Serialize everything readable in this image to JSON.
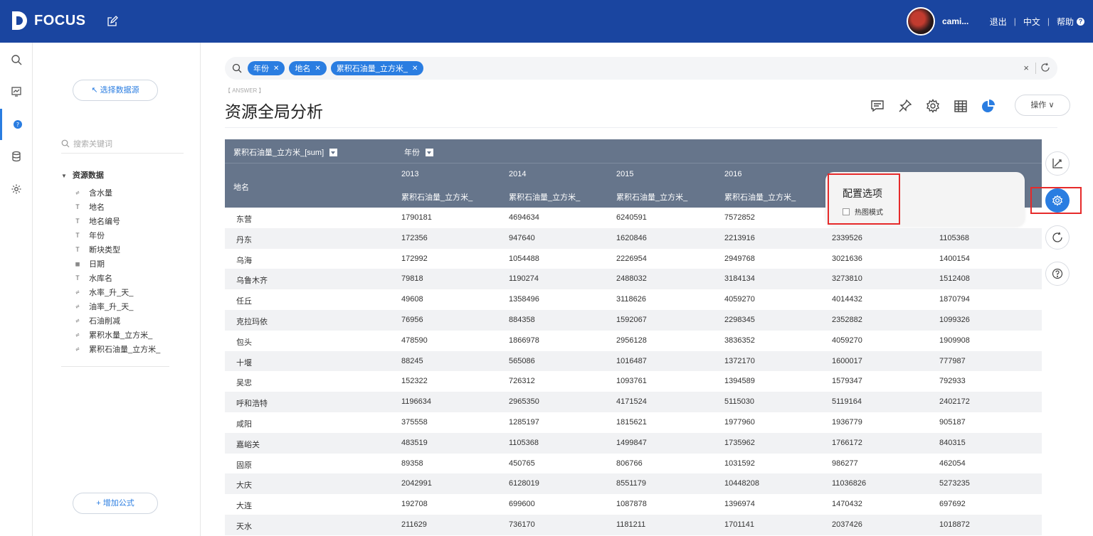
{
  "app": {
    "logo_text": "FOCUS"
  },
  "topbar": {
    "username": "cami...",
    "logout": "退出",
    "language": "中文",
    "help": "帮助"
  },
  "left_panel": {
    "select_source_label": "↖ 选择数据源",
    "search_placeholder": "搜索关键词",
    "group_label": "资源数据",
    "fields": [
      {
        "label": "含水量",
        "type": "number"
      },
      {
        "label": "地名",
        "type": "text"
      },
      {
        "label": "地名编号",
        "type": "text"
      },
      {
        "label": "年份",
        "type": "text"
      },
      {
        "label": "断块类型",
        "type": "text"
      },
      {
        "label": "日期",
        "type": "date"
      },
      {
        "label": "水库名",
        "type": "text"
      },
      {
        "label": "水率_升_天_",
        "type": "number"
      },
      {
        "label": "油率_升_天_",
        "type": "number"
      },
      {
        "label": "石油削减",
        "type": "number"
      },
      {
        "label": "累积水量_立方米_",
        "type": "number"
      },
      {
        "label": "累积石油量_立方米_",
        "type": "number"
      }
    ],
    "add_formula_label": "+ 增加公式"
  },
  "search": {
    "chips": [
      "年份",
      "地名",
      "累积石油量_立方米_"
    ],
    "clear": "×"
  },
  "answer": {
    "tag": "【 ANSWER 】",
    "title": "资源全局分析",
    "operation_button": "操作 ∨"
  },
  "table": {
    "measure_header": "累积石油量_立方米_[sum]",
    "pivot_header": "年份",
    "row_header": "地名",
    "years": [
      "2013",
      "2014",
      "2015",
      "2016",
      "",
      ""
    ],
    "subheaders": [
      "累积石油量_立方米_",
      "累积石油量_立方米_",
      "累积石油量_立方米_",
      "累积石油量_立方米_",
      "",
      ""
    ],
    "rows": [
      {
        "name": "东营",
        "values": [
          "1790181",
          "4694634",
          "6240591",
          "7572852",
          "",
          ""
        ]
      },
      {
        "name": "丹东",
        "values": [
          "172356",
          "947640",
          "1620846",
          "2213916",
          "2339526",
          "1105368"
        ]
      },
      {
        "name": "乌海",
        "values": [
          "172992",
          "1054488",
          "2226954",
          "2949768",
          "3021636",
          "1400154"
        ]
      },
      {
        "name": "乌鲁木齐",
        "values": [
          "79818",
          "1190274",
          "2488032",
          "3184134",
          "3273810",
          "1512408"
        ]
      },
      {
        "name": "任丘",
        "values": [
          "49608",
          "1358496",
          "3118626",
          "4059270",
          "4014432",
          "1870794"
        ]
      },
      {
        "name": "克拉玛依",
        "values": [
          "76956",
          "884358",
          "1592067",
          "2298345",
          "2352882",
          "1099326"
        ]
      },
      {
        "name": "包头",
        "values": [
          "478590",
          "1866978",
          "2956128",
          "3836352",
          "4059270",
          "1909908"
        ]
      },
      {
        "name": "十堰",
        "values": [
          "88245",
          "565086",
          "1016487",
          "1372170",
          "1600017",
          "777987"
        ]
      },
      {
        "name": "吴忠",
        "values": [
          "152322",
          "726312",
          "1093761",
          "1394589",
          "1579347",
          "792933"
        ]
      },
      {
        "name": "呼和浩特",
        "values": [
          "1196634",
          "2965350",
          "4171524",
          "5115030",
          "5119164",
          "2402172"
        ]
      },
      {
        "name": "咸阳",
        "values": [
          "375558",
          "1285197",
          "1815621",
          "1977960",
          "1936779",
          "905187"
        ]
      },
      {
        "name": "嘉峪关",
        "values": [
          "483519",
          "1105368",
          "1499847",
          "1735962",
          "1766172",
          "840315"
        ]
      },
      {
        "name": "固原",
        "values": [
          "89358",
          "450765",
          "806766",
          "1031592",
          "986277",
          "462054"
        ]
      },
      {
        "name": "大庆",
        "values": [
          "2042991",
          "6128019",
          "8551179",
          "10448208",
          "11036826",
          "5273235"
        ]
      },
      {
        "name": "大连",
        "values": [
          "192708",
          "699600",
          "1087878",
          "1396974",
          "1470432",
          "697692"
        ]
      },
      {
        "name": "天水",
        "values": [
          "211629",
          "736170",
          "1181211",
          "1701141",
          "2037426",
          "1018872"
        ]
      }
    ]
  },
  "popup": {
    "title": "配置选项",
    "heatmap_label": "热图模式",
    "heatmap_checked": false
  },
  "colors": {
    "topbar": "#1a45a0",
    "accent": "#2a7de1",
    "table_header": "#66758b",
    "highlight": "#e62a2a"
  }
}
